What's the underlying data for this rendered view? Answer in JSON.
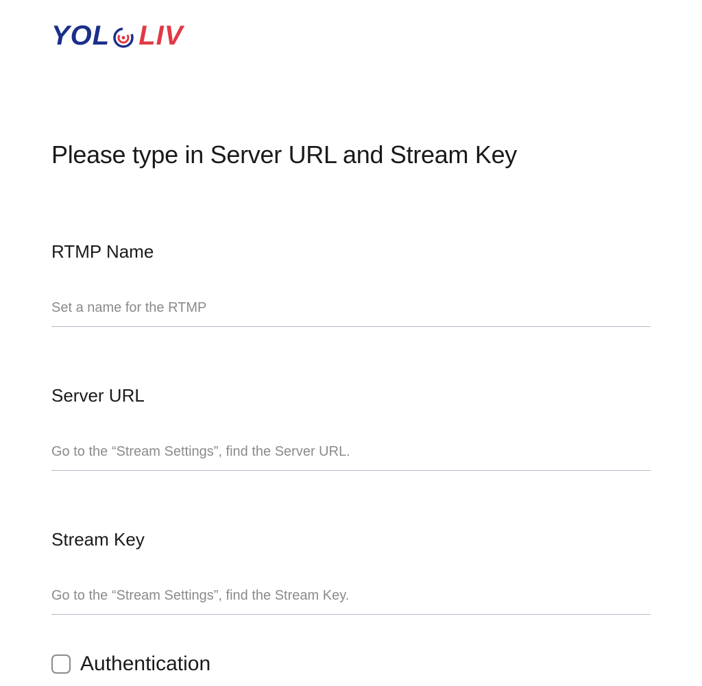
{
  "logo": {
    "part1": "YOL",
    "part2": "LIV"
  },
  "page": {
    "title": "Please type in Server URL and Stream Key"
  },
  "fields": {
    "rtmp_name": {
      "label": "RTMP Name",
      "placeholder": "Set a name for the RTMP",
      "value": ""
    },
    "server_url": {
      "label": "Server URL",
      "placeholder": "Go to the “Stream Settings”, find the Server URL.",
      "value": ""
    },
    "stream_key": {
      "label": "Stream Key",
      "placeholder": "Go to the “Stream Settings”, find the Stream Key.",
      "value": ""
    }
  },
  "auth": {
    "label": "Authentication",
    "checked": false
  }
}
